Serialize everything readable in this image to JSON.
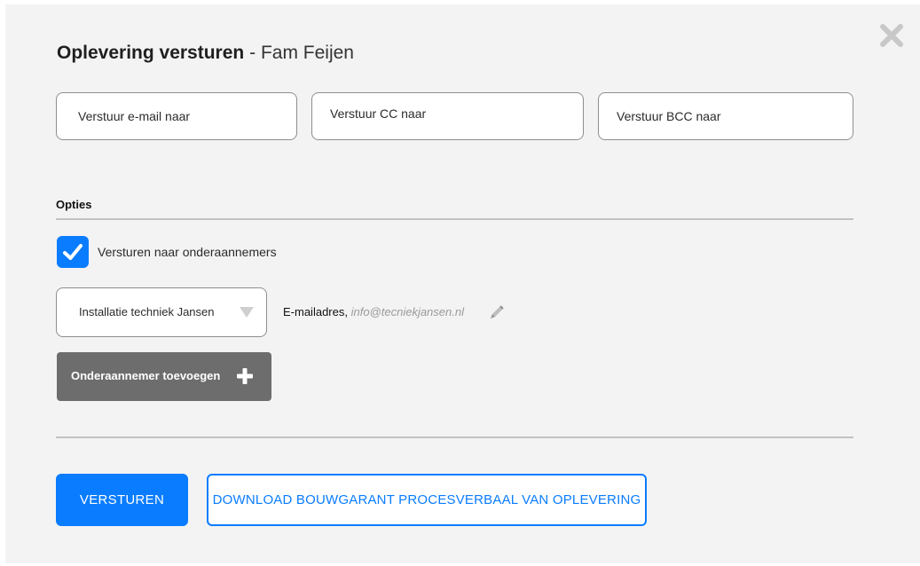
{
  "dialog": {
    "title_bold": "Oplevering versturen",
    "title_separator": "-",
    "title_name": "Fam Feijen",
    "close_icon": "close-icon"
  },
  "recipients": {
    "to_placeholder": "Verstuur e-mail naar",
    "cc_placeholder": "Verstuur CC naar",
    "bcc_placeholder": "Verstuur BCC naar"
  },
  "options": {
    "section_title": "Opties",
    "send_to_subcontractors_label": "Versturen naar onderaannemers",
    "send_to_subcontractors_checked": true,
    "subcontractor_select_value": "Installatie techniek Jansen",
    "email_label": "E-mailadres,",
    "email_value": "info@tecniekjansen.nl",
    "edit_icon": "pencil-icon",
    "add_subcontractor_label": "Onderaannemer toevoegen"
  },
  "actions": {
    "send_label": "VERSTUREN",
    "download_label": "DOWNLOAD BOUWGARANT PROCESVERBAAL VAN OPLEVERING"
  },
  "colors": {
    "accent": "#0a7cff",
    "modal_background": "#f3f3f3",
    "secondary_button": "#6d6d6d"
  }
}
